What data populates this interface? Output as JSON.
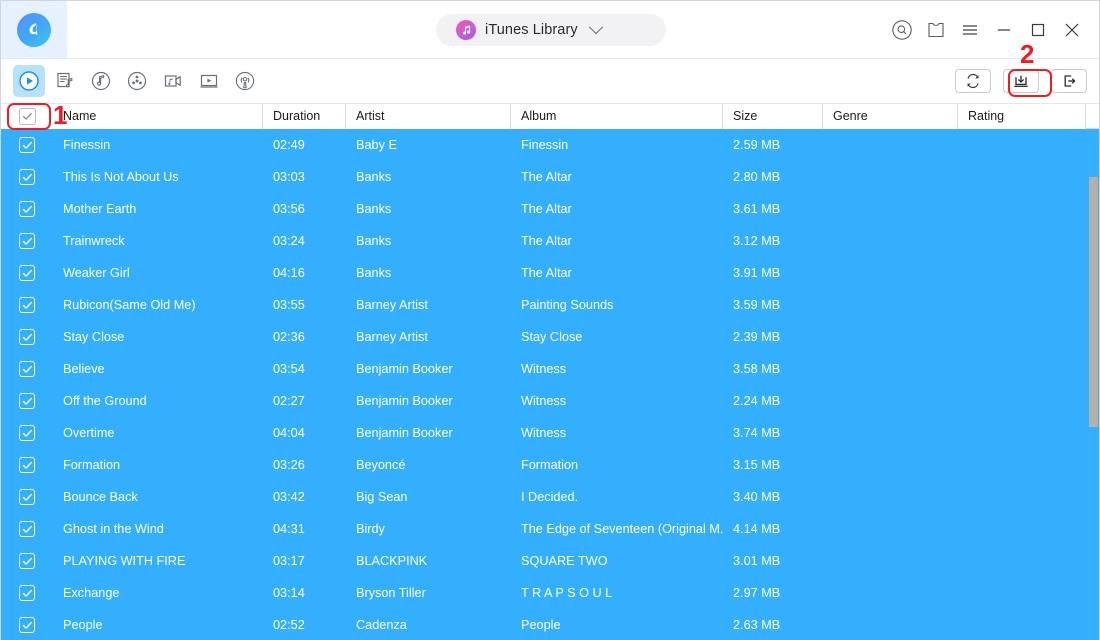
{
  "window": {
    "logo_icon": "app-logo-icon",
    "library_label": "iTunes Library",
    "library_icon": "music-note-icon",
    "chevron_icon": "chevron-down-icon",
    "controls": [
      {
        "name": "search-icon",
        "label": ""
      },
      {
        "name": "skin-tshirt-icon",
        "label": ""
      },
      {
        "name": "menu-icon",
        "label": ""
      },
      {
        "name": "minimize-icon",
        "label": ""
      },
      {
        "name": "maximize-icon",
        "label": ""
      },
      {
        "name": "close-icon",
        "label": ""
      }
    ]
  },
  "toolbar": {
    "categories": [
      {
        "name": "media-play-icon",
        "active": true
      },
      {
        "name": "playlist-icon",
        "active": false
      },
      {
        "name": "music-disc-icon",
        "active": false
      },
      {
        "name": "movie-reel-icon",
        "active": false
      },
      {
        "name": "music-video-icon",
        "active": false
      },
      {
        "name": "tv-show-icon",
        "active": false
      },
      {
        "name": "podcast-icon",
        "active": false
      }
    ],
    "actions": [
      {
        "name": "refresh-button",
        "icon": "refresh-icon"
      },
      {
        "name": "export-to-device-button",
        "icon": "export-icon"
      },
      {
        "name": "import-button",
        "icon": "import-icon"
      }
    ]
  },
  "annotations": [
    {
      "label": "1",
      "target": "select-all-checkbox"
    },
    {
      "label": "2",
      "target": "export-to-device-button"
    }
  ],
  "table": {
    "select_all_checked": true,
    "columns": [
      "Name",
      "Duration",
      "Artist",
      "Album",
      "Size",
      "Genre",
      "Rating"
    ],
    "rows": [
      {
        "checked": true,
        "name": "Finessin",
        "duration": "02:49",
        "artist": "Baby E",
        "album": "Finessin",
        "size": "2.59 MB",
        "genre": "",
        "rating": ""
      },
      {
        "checked": true,
        "name": "This Is Not About Us",
        "duration": "03:03",
        "artist": "Banks",
        "album": "The Altar",
        "size": "2.80 MB",
        "genre": "",
        "rating": ""
      },
      {
        "checked": true,
        "name": "Mother Earth",
        "duration": "03:56",
        "artist": "Banks",
        "album": "The Altar",
        "size": "3.61 MB",
        "genre": "",
        "rating": ""
      },
      {
        "checked": true,
        "name": "Trainwreck",
        "duration": "03:24",
        "artist": "Banks",
        "album": "The Altar",
        "size": "3.12 MB",
        "genre": "",
        "rating": ""
      },
      {
        "checked": true,
        "name": "Weaker Girl",
        "duration": "04:16",
        "artist": "Banks",
        "album": "The Altar",
        "size": "3.91 MB",
        "genre": "",
        "rating": ""
      },
      {
        "checked": true,
        "name": "Rubicon(Same Old Me)",
        "duration": "03:55",
        "artist": "Barney Artist",
        "album": "Painting Sounds",
        "size": "3.59 MB",
        "genre": "",
        "rating": ""
      },
      {
        "checked": true,
        "name": "Stay Close",
        "duration": "02:36",
        "artist": "Barney Artist",
        "album": "Stay Close",
        "size": "2.39 MB",
        "genre": "",
        "rating": ""
      },
      {
        "checked": true,
        "name": "Believe",
        "duration": "03:54",
        "artist": "Benjamin Booker",
        "album": "Witness",
        "size": "3.58 MB",
        "genre": "",
        "rating": ""
      },
      {
        "checked": true,
        "name": "Off the Ground",
        "duration": "02:27",
        "artist": "Benjamin Booker",
        "album": "Witness",
        "size": "2.24 MB",
        "genre": "",
        "rating": ""
      },
      {
        "checked": true,
        "name": "Overtime",
        "duration": "04:04",
        "artist": "Benjamin Booker",
        "album": "Witness",
        "size": "3.74 MB",
        "genre": "",
        "rating": ""
      },
      {
        "checked": true,
        "name": "Formation",
        "duration": "03:26",
        "artist": "Beyoncé",
        "album": "Formation",
        "size": "3.15 MB",
        "genre": "",
        "rating": ""
      },
      {
        "checked": true,
        "name": "Bounce Back",
        "duration": "03:42",
        "artist": "Big Sean",
        "album": "I Decided.",
        "size": "3.40 MB",
        "genre": "",
        "rating": ""
      },
      {
        "checked": true,
        "name": "Ghost in the Wind",
        "duration": "04:31",
        "artist": "Birdy",
        "album": "The Edge of Seventeen (Original M...",
        "size": "4.14 MB",
        "genre": "",
        "rating": ""
      },
      {
        "checked": true,
        "name": "PLAYING WITH FIRE",
        "duration": "03:17",
        "artist": "BLACKPINK",
        "album": "SQUARE TWO",
        "size": "3.01 MB",
        "genre": "",
        "rating": ""
      },
      {
        "checked": true,
        "name": "Exchange",
        "duration": "03:14",
        "artist": "Bryson Tiller",
        "album": "T R A P S O U L",
        "size": "2.97 MB",
        "genre": "",
        "rating": ""
      },
      {
        "checked": true,
        "name": "People",
        "duration": "02:52",
        "artist": "Cadenza",
        "album": "People",
        "size": "2.63 MB",
        "genre": "",
        "rating": ""
      }
    ]
  },
  "colors": {
    "selection_blue": "#33affd",
    "active_tab_blue": "#b6e2ff",
    "annotation_red": "#ee1d24",
    "header_text": "#1b1b1b"
  }
}
